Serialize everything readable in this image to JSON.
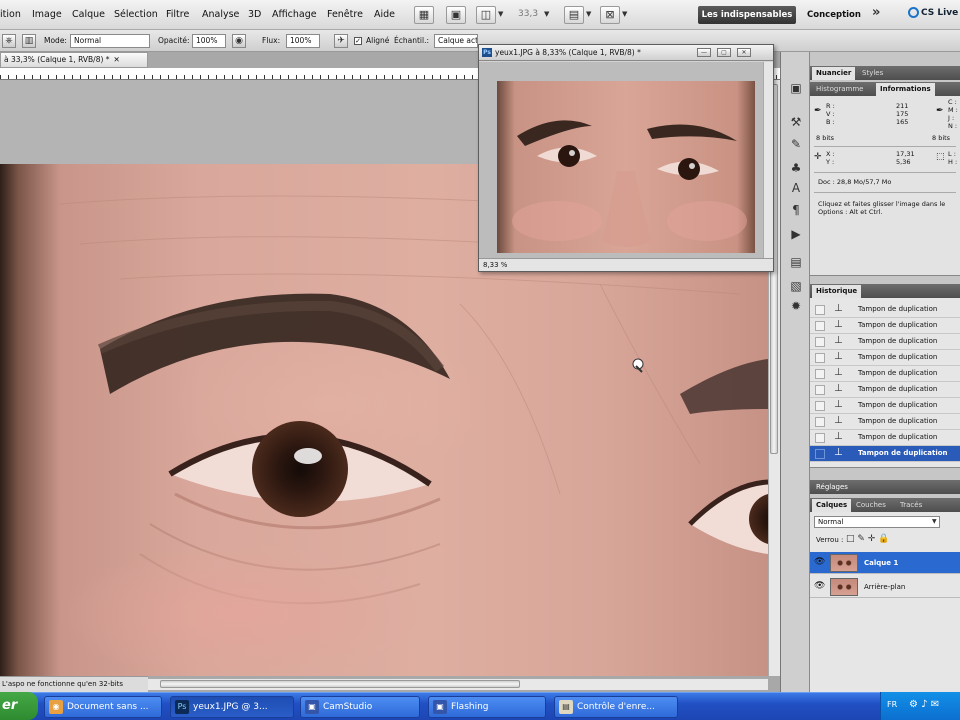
{
  "menubar": {
    "items": [
      "ition",
      "Image",
      "Calque",
      "Sélection",
      "Filtre",
      "Analyse",
      "3D",
      "Affichage",
      "Fenêtre",
      "Aide"
    ],
    "zoom_value": "33,3",
    "workspace_essentials": "Les indispensables",
    "workspace_design": "Conception",
    "cslive": "CS Live"
  },
  "options": {
    "mode_label": "Mode:",
    "mode_value": "Normal",
    "opacity_label": "Opacité:",
    "opacity_value": "100%",
    "flow_label": "Flux:",
    "flow_value": "100%",
    "aligned_label": "Aligné",
    "sample_label": "Échantil.:",
    "sample_value": "Calque actif"
  },
  "document": {
    "tab_title": "à 33,3% (Calque 1, RVB/8) *",
    "status_text": "L'aspo ne fonctionne qu'en 32-bits"
  },
  "floating_window": {
    "title": "yeux1.JPG à 8,33% (Calque 1, RVB/8) *",
    "zoom": "8,33 %"
  },
  "panels": {
    "top_tabs": [
      "Nuancier",
      "Styles"
    ],
    "info_tabs": [
      "Histogramme",
      "Informations"
    ],
    "info": {
      "r_label": "R :",
      "g_label": "V :",
      "b_label": "B :",
      "r": "211",
      "g": "175",
      "b": "165",
      "c_label": "C :",
      "m_label": "M :",
      "y_label": "J :",
      "k_label": "N :",
      "bits_left": "8 bits",
      "bits_right": "8 bits",
      "x_label": "X :",
      "y_coord_label": "Y :",
      "x": "17,31",
      "y": "5,36",
      "w_label": "L :",
      "h_label": "H :",
      "doc": "Doc : 28,8 Mo/57,7 Mo",
      "hint_1": "Cliquez et faites glisser l'image dans le",
      "hint_2": "Options : Alt et Ctrl."
    },
    "history_tab": "Historique",
    "history_items": [
      "Tampon de duplication",
      "Tampon de duplication",
      "Tampon de duplication",
      "Tampon de duplication",
      "Tampon de duplication",
      "Tampon de duplication",
      "Tampon de duplication",
      "Tampon de duplication",
      "Tampon de duplication",
      "Tampon de duplication"
    ],
    "adjust_tab": "Réglages",
    "layers_tabs": [
      "Calques",
      "Couches",
      "Tracés"
    ],
    "blend_mode": "Normal",
    "lock_label": "Verrou :",
    "layers": [
      "Calque 1",
      "Arrière-plan"
    ]
  },
  "taskbar": {
    "start": "er",
    "tasks": [
      "Document sans ...",
      "yeux1.JPG @ 3...",
      "CamStudio",
      "Flashing",
      "Contrôle d'enre..."
    ],
    "lang": "FR"
  },
  "colors": {
    "selection_blue": "#2a5bb8",
    "taskbar_blue": "#2150c4",
    "panel_header": "#5a5a5a"
  }
}
